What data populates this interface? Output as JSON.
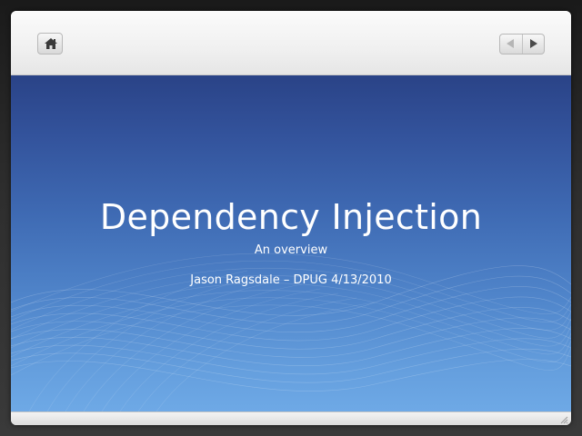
{
  "toolbar": {
    "home_icon": "home-icon",
    "prev_icon": "arrow-left-icon",
    "next_icon": "arrow-right-icon"
  },
  "slide": {
    "title": "Dependency Injection",
    "subtitle": "An overview",
    "byline": "Jason Ragsdale – DPUG 4/13/2010"
  },
  "colors": {
    "slide_top": "#2a4387",
    "slide_bottom": "#6ea9e6",
    "text": "#ffffff"
  }
}
